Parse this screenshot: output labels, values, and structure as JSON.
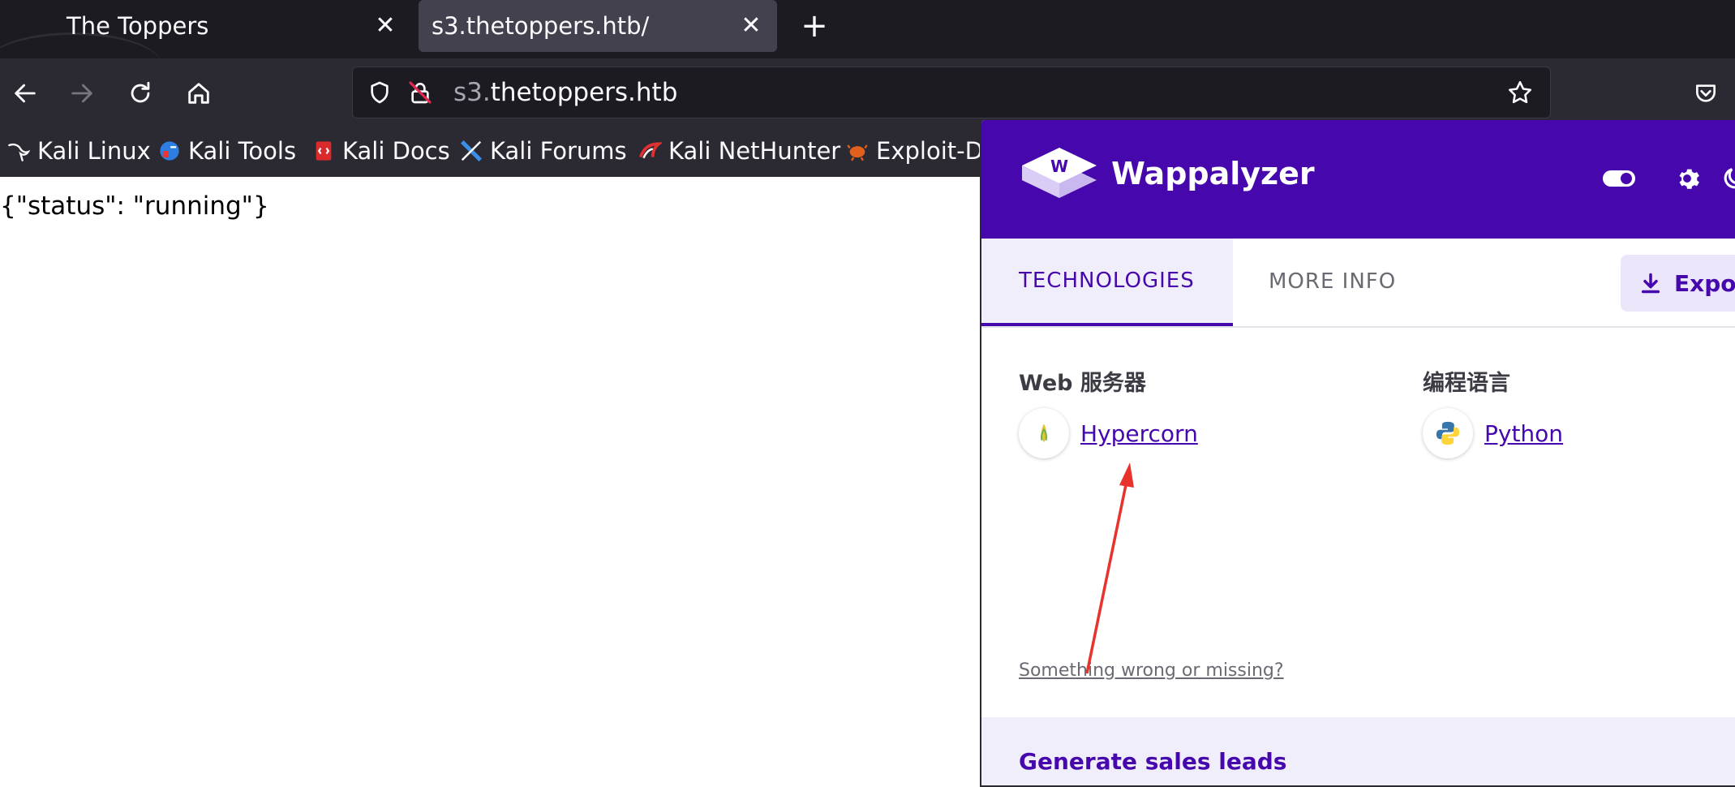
{
  "browser": {
    "tabs": [
      {
        "title": "The Toppers",
        "close": "✕"
      },
      {
        "title": "s3.thetoppers.htb/",
        "close": "✕"
      }
    ],
    "new_tab": "+",
    "url": {
      "prefix": "s3.",
      "host": "thetoppers.htb"
    },
    "icons": {
      "back": "back-arrow-icon",
      "forward": "forward-arrow-icon",
      "reload": "reload-icon",
      "home": "home-icon",
      "shield": "tracking-shield-icon",
      "lock": "insecure-lock-icon",
      "bookmark_star": "star-icon",
      "pocket": "pocket-icon"
    },
    "bookmarks": [
      {
        "label": "Kali Linux",
        "icon": "kali-dragon-icon"
      },
      {
        "label": "Kali Tools",
        "icon": "kali-tools-icon"
      },
      {
        "label": "Kali Docs",
        "icon": "kali-docs-icon"
      },
      {
        "label": "Kali Forums",
        "icon": "kali-forums-icon"
      },
      {
        "label": "Kali NetHunter",
        "icon": "nethunter-icon"
      },
      {
        "label": "Exploit-D",
        "icon": "exploit-db-icon"
      }
    ]
  },
  "page": {
    "body_text": "{\"status\": \"running\"}"
  },
  "wappalyzer": {
    "title": "Wappalyzer",
    "tabs": {
      "technologies": "TECHNOLOGIES",
      "more_info": "MORE INFO"
    },
    "export_label": "Expor",
    "categories": [
      {
        "name": "Web 服务器",
        "tech": "Hypercorn",
        "icon": "hypercorn-icon"
      },
      {
        "name": "编程语言",
        "tech": "Python",
        "icon": "python-icon"
      }
    ],
    "wrong_link": "Something wrong or missing?",
    "footer_title": "Generate sales leads",
    "colors": {
      "brand": "#4608ad",
      "tab_bg": "#f1eefb",
      "annotation": "#e8322c"
    }
  }
}
